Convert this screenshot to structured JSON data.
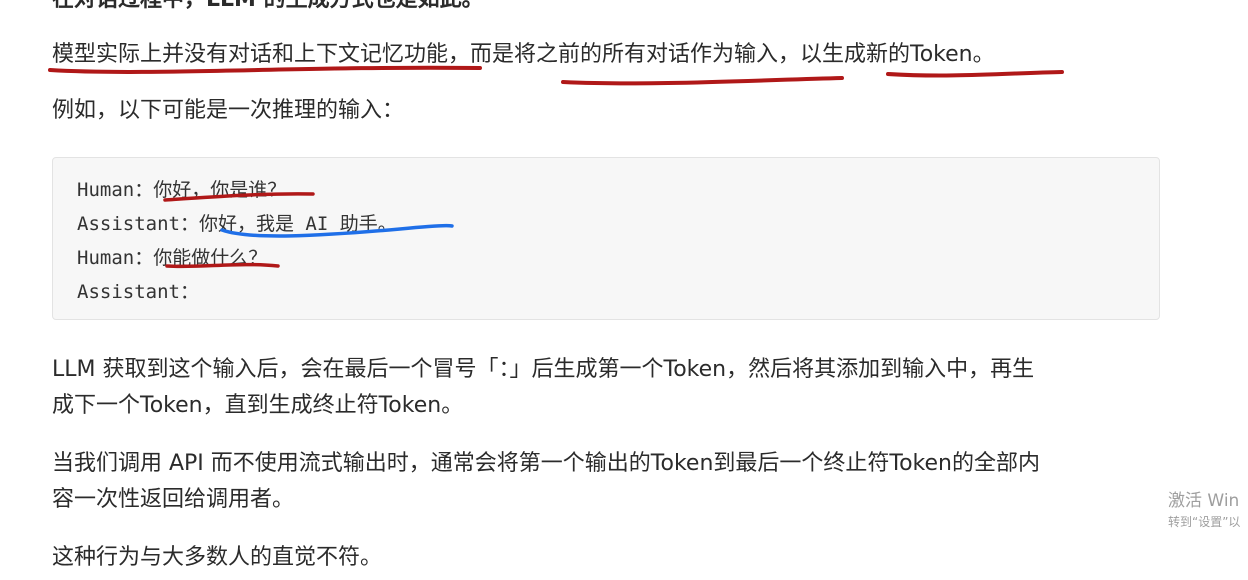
{
  "top_heading": "在对话过程中，LLM 的生成方式也是如此。",
  "para1": "模型实际上并没有对话和上下文记忆功能，而是将之前的所有对话作为输入，以生成新的Token。",
  "para2": "例如，以下可能是一次推理的输入：",
  "code_lines": [
    "Human：你好，你是谁？",
    "Assistant：你好，我是 AI 助手。",
    "Human：你能做什么？",
    "Assistant："
  ],
  "para3": [
    "LLM 获取到这个输入后，会在最后一个冒号「：」后生成第一个Token，然后将其添加到输入中，再生",
    "成下一个Token，直到生成终止符Token。"
  ],
  "para4": [
    "当我们调用 API 而不使用流式输出时，通常会将第一个输出的Token到最后一个终止符Token的全部内",
    "容一次性返回给调用者。"
  ],
  "para5": "这种行为与大多数人的直觉不符。",
  "watermark": {
    "line1": "激活 Win",
    "line2": "转到“设置”以"
  },
  "colors": {
    "red_annotation": "#b01818",
    "blue_annotation": "#1f6fe8",
    "code_bg": "#f7f7f7"
  }
}
